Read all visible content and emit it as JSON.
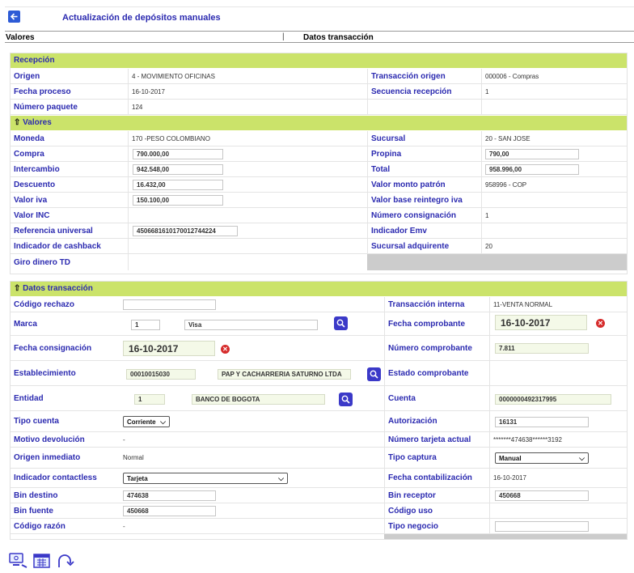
{
  "header": {
    "title": "Actualización de depósitos manuales"
  },
  "sections": {
    "left": "Valores",
    "separator": "|",
    "right": "Datos transacción"
  },
  "recepcion": {
    "title": "Recepción",
    "rows": [
      {
        "l1": "Origen",
        "v1": "4 - MOVIMIENTO OFICINAS",
        "l2": "Transacción origen",
        "v2": "000006 - Compras"
      },
      {
        "l1": "Fecha proceso",
        "v1": "16-10-2017",
        "l2": "Secuencia recepción",
        "v2": "1"
      },
      {
        "l1": "Número paquete",
        "v1": "124",
        "l2": "",
        "v2": ""
      }
    ]
  },
  "valores": {
    "title": "Valores",
    "moneda_label": "Moneda",
    "moneda": "170 -PESO COLOMBIANO",
    "sucursal_label": "Sucursal",
    "sucursal": "20 - SAN JOSE",
    "compra_label": "Compra",
    "compra": "790.000,00",
    "propina_label": "Propina",
    "propina": "790,00",
    "intercambio_label": "Intercambio",
    "intercambio": "942.548,00",
    "total_label": "Total",
    "total": "958.996,00",
    "descuento_label": "Descuento",
    "descuento": "16.432,00",
    "valor_monto_patron_label": "Valor monto patrón",
    "valor_monto_patron": "958996 - COP",
    "valor_iva_label": "Valor iva",
    "valor_iva": "150.100,00",
    "valor_base_label": "Valor base reintegro iva",
    "valor_base": "",
    "valor_inc_label": "Valor INC",
    "valor_inc": "",
    "numero_consignacion_label": "Número consignación",
    "numero_consignacion": "1",
    "referencia_label": "Referencia universal",
    "referencia": "45066816101700127442​24",
    "indicador_emv_label": "Indicador Emv",
    "indicador_emv": "",
    "cashback_label": "Indicador de cashback",
    "cashback": "",
    "sucursal_adq_label": "Sucursal adquirente",
    "sucursal_adq": "20",
    "giro_label": "Giro dinero TD",
    "giro": ""
  },
  "datos": {
    "title": "Datos transacción",
    "codigo_rechazo_label": "Código rechazo",
    "codigo_rechazo": "",
    "transaccion_interna_label": "Transacción interna",
    "transaccion_interna": "11-VENTA NORMAL",
    "marca_label": "Marca",
    "marca_code": "1",
    "marca_name": "Visa",
    "fecha_comprobante_label": "Fecha comprobante",
    "fecha_comprobante": "16-10-2017",
    "fecha_consignacion_label": "Fecha consignación",
    "fecha_consignacion": "16-10-2017",
    "numero_comprobante_label": "Número comprobante",
    "numero_comprobante": "7.811",
    "establecimiento_label": "Establecimiento",
    "establecimiento_code": "00010015030",
    "establecimiento_name": "PAP Y CACHARRERIA SATURNO LTDA",
    "estado_comprobante_label": "Estado comprobante",
    "estado_comprobante": "",
    "entidad_label": "Entidad",
    "entidad_code": "1",
    "entidad_name": "BANCO DE BOGOTA",
    "cuenta_label": "Cuenta",
    "cuenta": "0000000492317995",
    "tipo_cuenta_label": "Tipo cuenta",
    "tipo_cuenta": "Corriente",
    "autorizacion_label": "Autorización",
    "autorizacion": "16131",
    "motivo_label": "Motivo devolución",
    "motivo": "-",
    "numero_tarjeta_label": "Número tarjeta actual",
    "numero_tarjeta": "*******474638******3192",
    "origen_inmediato_label": "Origen inmediato",
    "origen_inmediato": "Normal",
    "tipo_captura_label": "Tipo captura",
    "tipo_captura": "Manual",
    "contactless_label": "Indicador contactless",
    "contactless": "Tarjeta",
    "fecha_contab_label": "Fecha contabilización",
    "fecha_contab": "16-10-2017",
    "bin_destino_label": "Bin destino",
    "bin_destino": "474638",
    "bin_receptor_label": "Bin receptor",
    "bin_receptor": "450668",
    "bin_fuente_label": "Bin fuente",
    "bin_fuente": "450668",
    "codigo_uso_label": "Código uso",
    "codigo_uso": "",
    "codigo_razon_label": "Código razón",
    "codigo_razon": "-",
    "tipo_negocio_label": "Tipo negocio",
    "tipo_negocio": ""
  },
  "colors": {
    "label": "#2b2ab0",
    "header_bg": "#cbe36a",
    "accent": "#3b39c8",
    "clear": "#d62c2c"
  },
  "icons": [
    "back-arrow-icon",
    "search-icon",
    "clear-icon",
    "collapse-arrow-icon",
    "monitor-icon",
    "calendar-grid-icon",
    "return-arrow-icon"
  ]
}
